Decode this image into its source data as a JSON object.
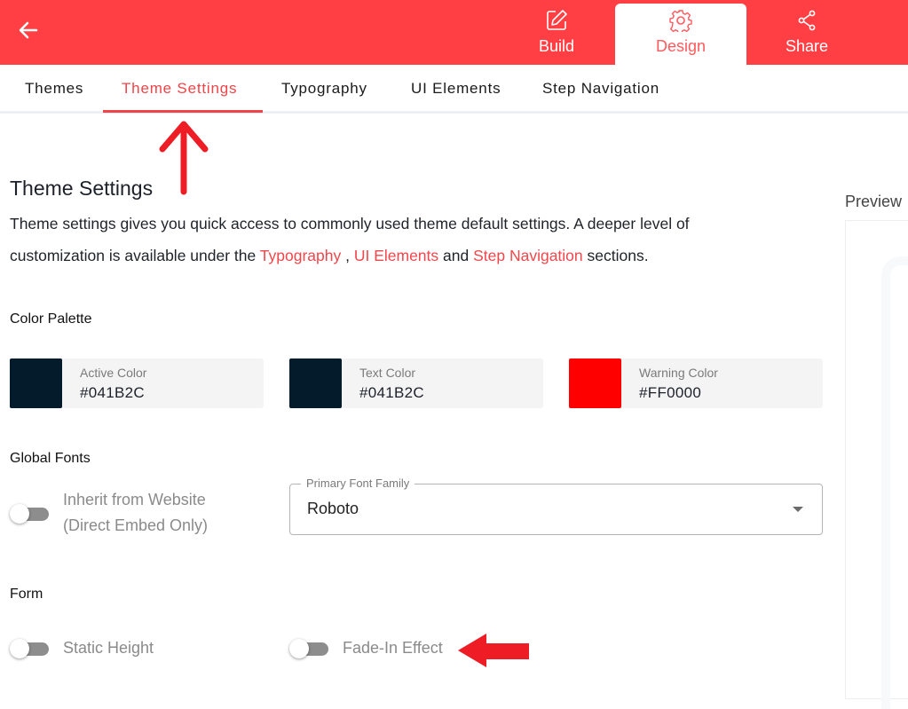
{
  "header": {
    "back_icon": "arrow-left-icon",
    "mode_tabs": [
      {
        "label": "Build",
        "icon": "edit-icon",
        "active": false
      },
      {
        "label": "Design",
        "icon": "gear-icon",
        "active": true
      },
      {
        "label": "Share",
        "icon": "share-icon",
        "active": false
      }
    ],
    "brand_color": "#FF3F43"
  },
  "subnav": {
    "tabs": [
      {
        "label": "Themes",
        "active": false
      },
      {
        "label": "Theme Settings",
        "active": true
      },
      {
        "label": "Typography",
        "active": false
      },
      {
        "label": "UI Elements",
        "active": false
      },
      {
        "label": "Step Navigation",
        "active": false
      }
    ]
  },
  "main": {
    "title": "Theme Settings",
    "description": {
      "line1": "Theme settings gives you quick access to commonly used theme default settings. A deeper level of",
      "line2_prefix": "customization is available under the ",
      "link_typography": "Typography",
      "sep1": " , ",
      "link_ui_elements": "UI Elements",
      "sep2": " and ",
      "link_step_navigation": "Step Navigation",
      "suffix": " sections."
    },
    "color_palette": {
      "title": "Color Palette",
      "swatches": [
        {
          "name": "Active Color",
          "value": "#041B2C",
          "color": "#041B2C"
        },
        {
          "name": "Text Color",
          "value": "#041B2C",
          "color": "#041B2C"
        },
        {
          "name": "Warning Color",
          "value": "#FF0000",
          "color": "#FF0000"
        }
      ]
    },
    "global_fonts": {
      "title": "Global Fonts",
      "inherit_toggle": {
        "label_line1": "Inherit from Website",
        "label_line2": "(Direct Embed Only)",
        "on": false
      },
      "primary_font": {
        "label": "Primary Font Family",
        "value": "Roboto"
      }
    },
    "form": {
      "title": "Form",
      "static_height": {
        "label": "Static Height",
        "on": false
      },
      "fade_in": {
        "label": "Fade-In Effect",
        "on": false
      }
    }
  },
  "preview": {
    "label": "Preview"
  },
  "annotations": {
    "arrow_color": "#EE1C25"
  }
}
